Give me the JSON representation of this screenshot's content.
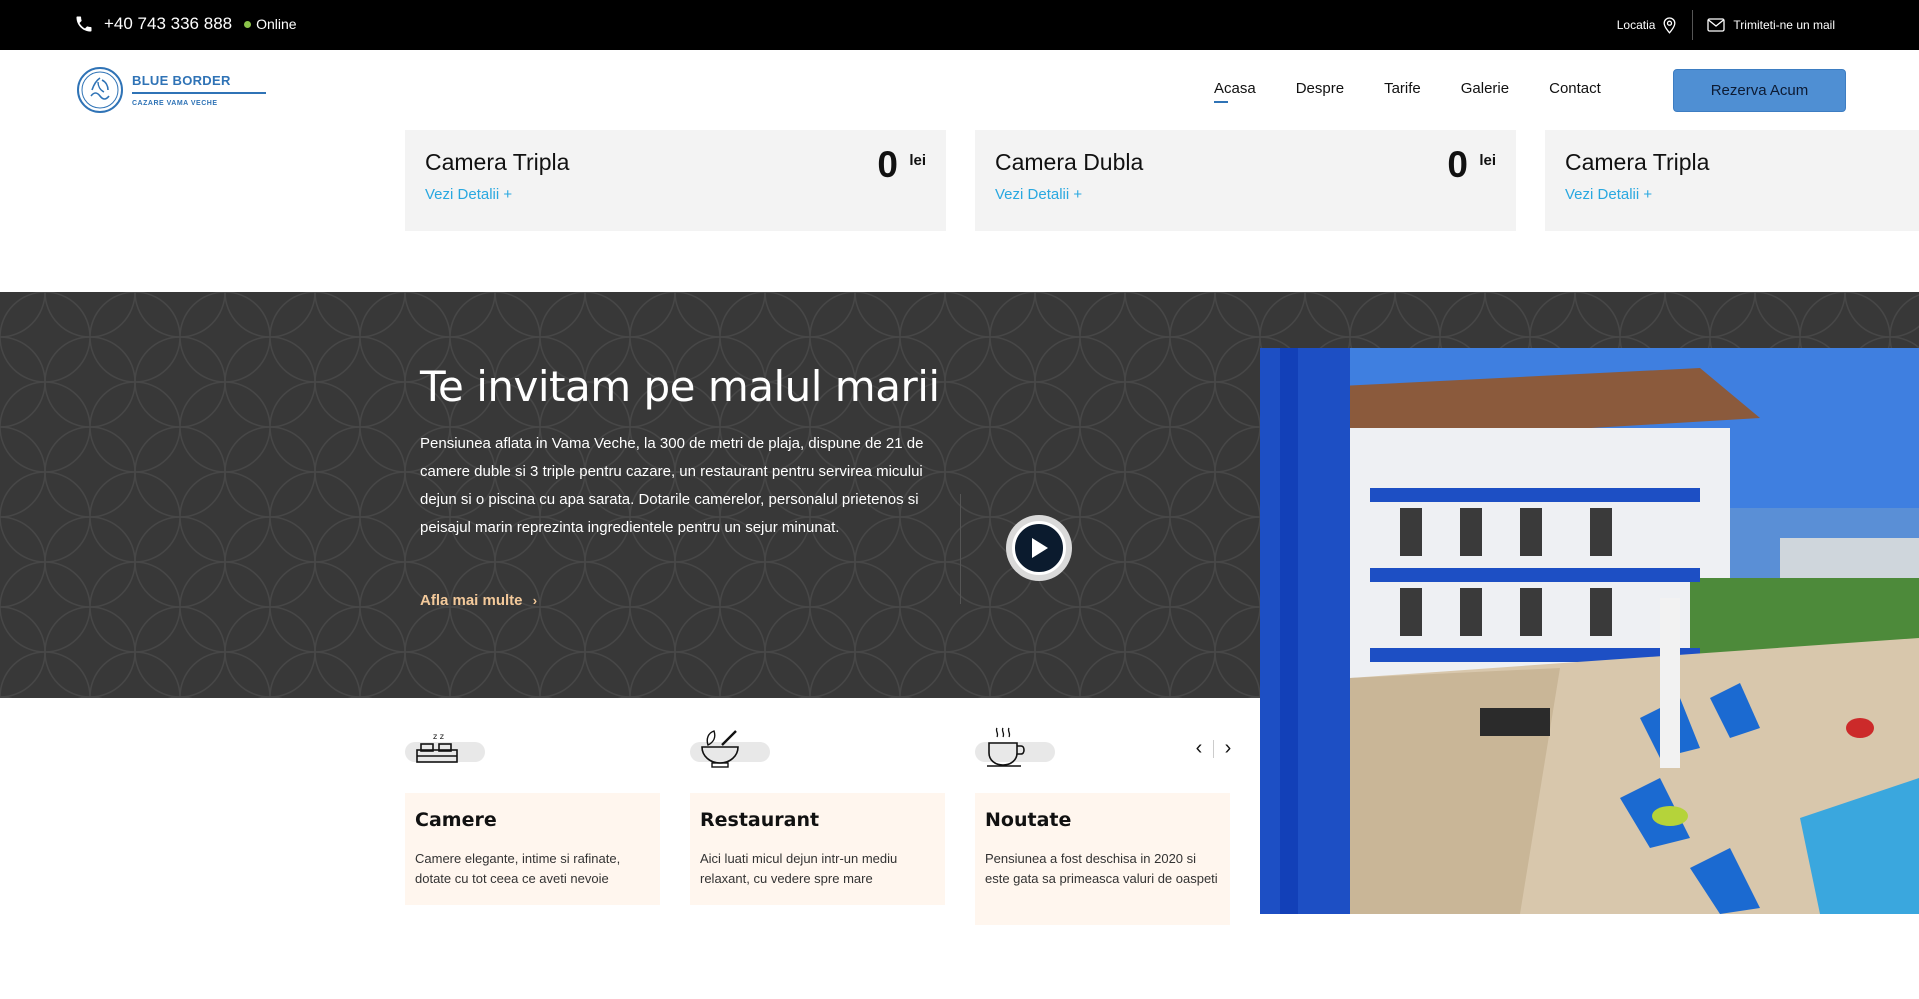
{
  "topbar": {
    "phone": "+40 743 336 888",
    "status": "Online",
    "location_label": "Locatia",
    "mail_label": "Trimiteti-ne un mail"
  },
  "header": {
    "logo_title": "BLUE BORDER",
    "logo_subtitle": "CAZARE VAMA VECHE",
    "nav": [
      {
        "label": "Acasa",
        "active": true
      },
      {
        "label": "Despre",
        "active": false
      },
      {
        "label": "Tarife",
        "active": false
      },
      {
        "label": "Galerie",
        "active": false
      },
      {
        "label": "Contact",
        "active": false
      }
    ],
    "cta_label": "Rezerva Acum"
  },
  "rooms": [
    {
      "name": "Camera Tripla",
      "details": "Vezi Detalii +",
      "price": "0",
      "currency": "lei"
    },
    {
      "name": "Camera Dubla",
      "details": "Vezi Detalii +",
      "price": "0",
      "currency": "lei"
    },
    {
      "name": "Camera Tripla",
      "details": "Vezi Detalii +",
      "price": "",
      "currency": ""
    }
  ],
  "intro": {
    "title": "Te invitam pe malul marii",
    "description": "Pensiunea aflata in Vama Veche, la 300 de metri de plaja, dispune de 21 de camere duble si 3 triple pentru cazare, un restaurant pentru servirea micului dejun si o piscina cu apa sarata. Dotarile camerelor, personalul prietenos si peisajul marin reprezinta ingredientele pentru un sejur minunat.",
    "more_label": "Afla mai multe"
  },
  "features": [
    {
      "icon": "bed-icon",
      "title": "Camere",
      "text": "Camere elegante, intime si rafinate, dotate cu tot ceea ce aveti nevoie"
    },
    {
      "icon": "mortar-pestle-icon",
      "title": "Restaurant",
      "text": "Aici luati micul dejun intr-un mediu relaxant, cu vedere spre mare"
    },
    {
      "icon": "coffee-cup-icon",
      "title": "Noutate",
      "text": "Pensiunea a fost deschisa in 2020 si este gata sa primeasca valuri de oaspeti"
    }
  ],
  "colors": {
    "brand_blue": "#2f73b6",
    "cta": "#4f8fd3",
    "link": "#29a8e0",
    "accent_orange": "#f3c99a",
    "dark_bg": "#383838"
  }
}
